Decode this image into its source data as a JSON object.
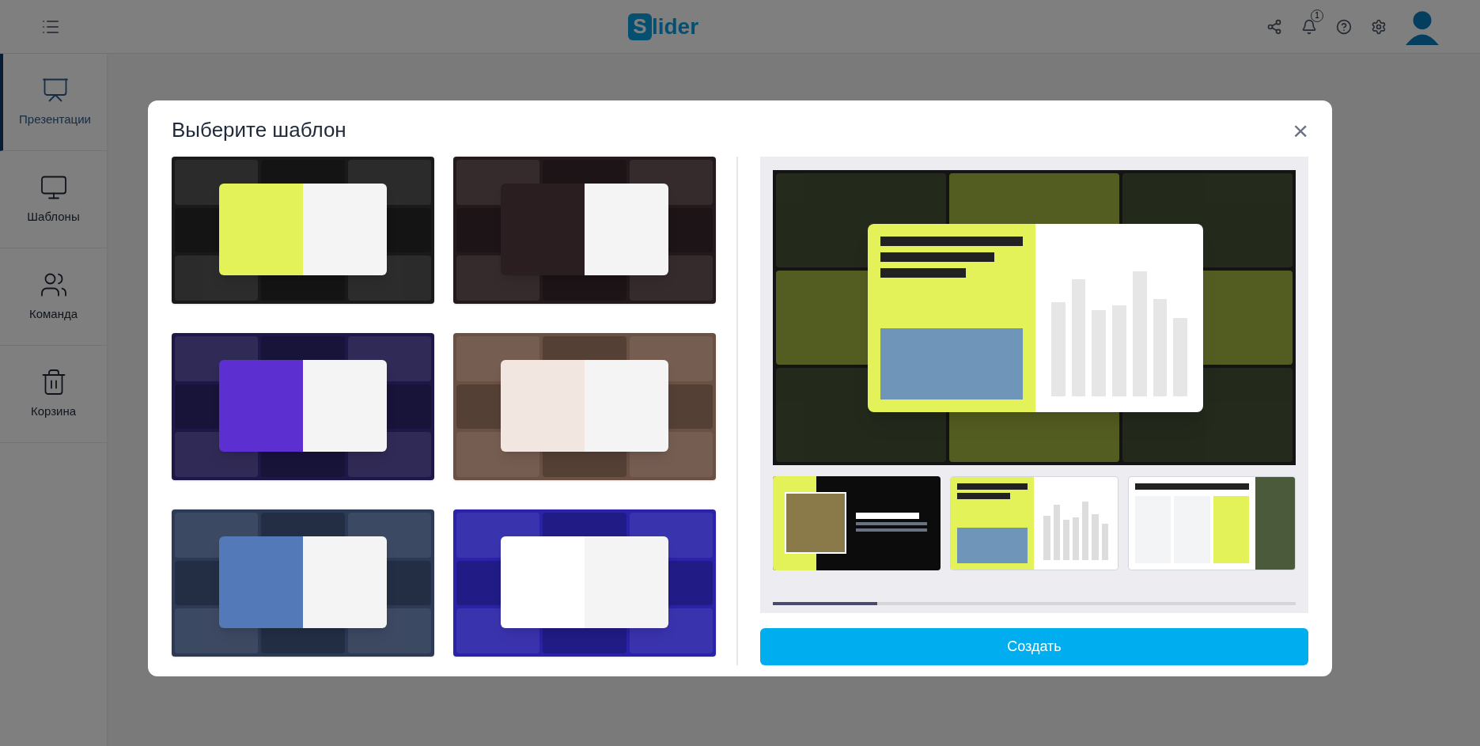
{
  "header": {
    "logo_mark": "S",
    "logo_text": "lider",
    "notification_count": "1"
  },
  "sidebar": {
    "items": [
      {
        "label": "Презентации",
        "kind": "presentations",
        "selected": true
      },
      {
        "label": "Шаблоны",
        "kind": "templates",
        "selected": false
      },
      {
        "label": "Команда",
        "kind": "team",
        "selected": false
      },
      {
        "label": "Корзина",
        "kind": "trash",
        "selected": false
      }
    ]
  },
  "dialog": {
    "title": "Выберите шаблон",
    "close": "×",
    "templates": [
      {
        "color": "#1a1a1a"
      },
      {
        "color": "#241a1c"
      },
      {
        "color": "#1e1848"
      },
      {
        "color": "#6b5044"
      },
      {
        "color": "#2c3a55"
      },
      {
        "color": "#2a22a8"
      }
    ],
    "slides": [
      {
        "kind": "photo"
      },
      {
        "kind": "chart"
      },
      {
        "kind": "columns"
      }
    ],
    "carousel": {
      "level": 0.2
    },
    "create_button": "Создать"
  }
}
